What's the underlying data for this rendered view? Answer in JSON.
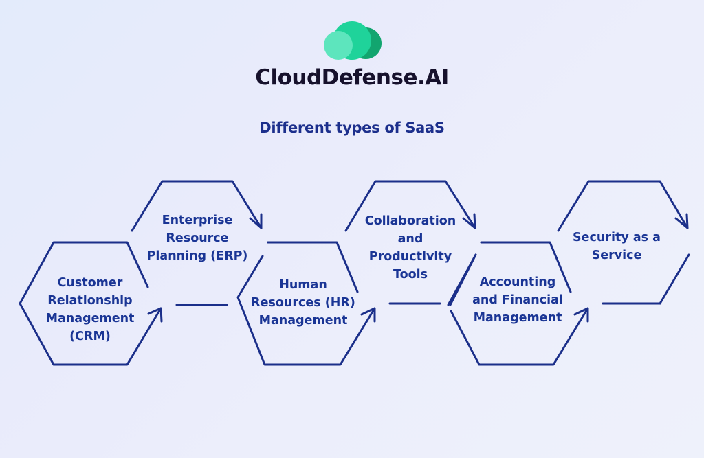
{
  "brand": {
    "name": "CloudDefense.AI",
    "logo_icon": "cloud-logo-icon",
    "colors": {
      "light": "#5de5bd",
      "mid": "#1fd39a",
      "dark": "#12a56f",
      "text": "#16112c"
    }
  },
  "subtitle": "Different types of SaaS",
  "colors": {
    "outline": "#1b2f8a",
    "label": "#1a3595",
    "subtitle": "#1c2f8c"
  },
  "types": [
    {
      "id": "crm",
      "lines": [
        "Customer",
        "Relationship",
        "Management",
        "(CRM)"
      ]
    },
    {
      "id": "erp",
      "lines": [
        "Enterprise",
        "Resource",
        "Planning (ERP)"
      ]
    },
    {
      "id": "hr",
      "lines": [
        "Human",
        "Resources (HR)",
        "Management"
      ]
    },
    {
      "id": "collab",
      "lines": [
        "Collaboration",
        "and",
        "Productivity",
        "Tools"
      ]
    },
    {
      "id": "accounting",
      "lines": [
        "Accounting",
        "and Financial",
        "Management"
      ]
    },
    {
      "id": "secaas",
      "lines": [
        "Security as a",
        "Service"
      ]
    }
  ]
}
